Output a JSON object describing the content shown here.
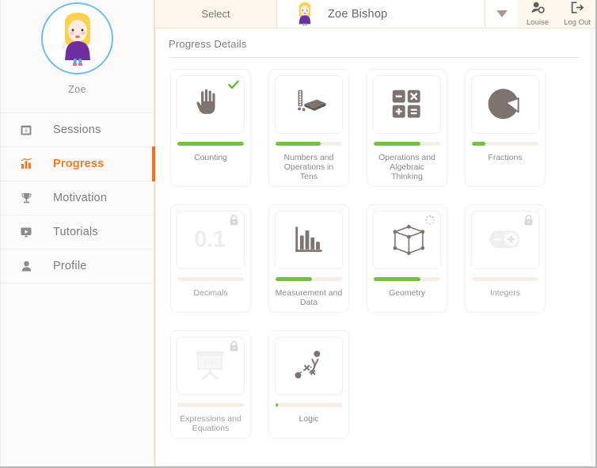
{
  "sidebar": {
    "avatar_name": "Zoe",
    "avatar_icon": "girl-avatar-illustration",
    "items": [
      {
        "label": "Sessions",
        "icon": "calendar-icon",
        "active": false
      },
      {
        "label": "Progress",
        "icon": "bar-chart-icon",
        "active": true
      },
      {
        "label": "Motivation",
        "icon": "trophy-icon",
        "active": false
      },
      {
        "label": "Tutorials",
        "icon": "video-icon",
        "active": false
      },
      {
        "label": "Profile",
        "icon": "person-icon",
        "active": false
      }
    ]
  },
  "topbar": {
    "select_label": "Select",
    "student_name": "Zoe Bishop",
    "student_avatar_icon": "girl-avatar-small",
    "caret_icon": "chevron-down-icon",
    "actions": [
      {
        "label": "Louise",
        "icon": "user-account-icon"
      },
      {
        "label": "Log Out",
        "icon": "logout-icon"
      }
    ]
  },
  "main": {
    "panel_title": "Progress Details",
    "accent_green": "#72c241",
    "accent_orange": "#f2711c",
    "track_color": "#f4efe6",
    "cards": [
      {
        "label": "Counting",
        "icon": "hand-counting-icon",
        "progress": 100,
        "locked": false,
        "badge": "check-icon"
      },
      {
        "label": "Numbers and Operations in Tens",
        "icon": "base-ten-blocks-icon",
        "progress": 68,
        "locked": false,
        "badge": ""
      },
      {
        "label": "Operations and Algebraic Thinking",
        "icon": "calculator-operators-icon",
        "progress": 70,
        "locked": false,
        "badge": ""
      },
      {
        "label": "Fractions",
        "icon": "pie-chart-slice-icon",
        "progress": 20,
        "locked": false,
        "badge": ""
      },
      {
        "label": "Decimals",
        "icon": "decimal-number-icon",
        "progress": 0,
        "locked": true,
        "badge": "lock-icon"
      },
      {
        "label": "Measurement and Data",
        "icon": "bar-graph-icon",
        "progress": 55,
        "locked": false,
        "badge": ""
      },
      {
        "label": "Geometry",
        "icon": "cube-wireframe-icon",
        "progress": 70,
        "locked": false,
        "badge": "spinner-icon"
      },
      {
        "label": "Integers",
        "icon": "plus-minus-toggle-icon",
        "progress": 0,
        "locked": true,
        "badge": "lock-icon"
      },
      {
        "label": "Expressions and Equations",
        "icon": "whiteboard-equation-icon",
        "progress": 0,
        "locked": true,
        "badge": "lock-icon"
      },
      {
        "label": "Logic",
        "icon": "logic-path-icon",
        "progress": 3,
        "locked": false,
        "badge": ""
      }
    ]
  }
}
